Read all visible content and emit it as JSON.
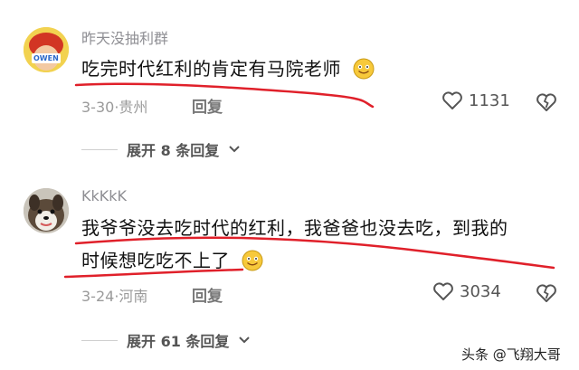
{
  "comments": [
    {
      "username": "昨天没抽利群",
      "text_lines": [
        "吃完时代红利的肯定有马院老师"
      ],
      "date": "3-30",
      "location": "贵州",
      "reply_label": "回复",
      "likes": "1131",
      "expand_label": "展开 8 条回复",
      "avatar_badge": "OWEN"
    },
    {
      "username": "KkKkK",
      "text_lines": [
        "我爷爷没去吃时代的红利，我爸爸也没去吃，到我的",
        "时候想吃吃不上了"
      ],
      "date": "3-24",
      "location": "河南",
      "reply_label": "回复",
      "likes": "3034",
      "expand_label": "展开 61 条回复"
    }
  ],
  "meta_separator": "·",
  "watermark": "头条 @飞翔大哥",
  "icons": [
    "emoji-smile-icon",
    "heart-icon",
    "broken-heart-icon",
    "chevron-down-icon"
  ],
  "colors": {
    "annotation_red": "#e0202a",
    "text_gray": "#9a9a9a"
  }
}
